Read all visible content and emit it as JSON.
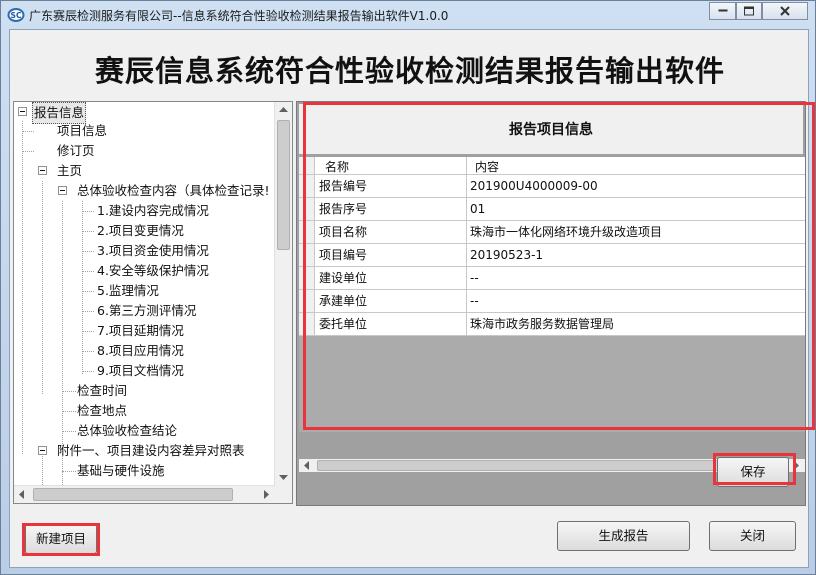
{
  "window": {
    "title": "广东赛辰检测服务有限公司--信息系统符合性验收检测结果报告输出软件V1.0.0",
    "logo_text": "SC",
    "controls": [
      "minimize-icon",
      "maximize-icon",
      "close-icon"
    ]
  },
  "header": {
    "title": "赛辰信息系统符合性验收检测结果报告输出软件"
  },
  "tree": {
    "nodes": [
      {
        "label": "报告信息",
        "expanded": true,
        "selected": true
      },
      {
        "label": "项目信息"
      },
      {
        "label": "修订页"
      },
      {
        "label": "主页",
        "expanded": true
      },
      {
        "label": "总体验收检查内容（具体检查记录!",
        "expanded": true
      },
      {
        "label": "1.建设内容完成情况"
      },
      {
        "label": "2.项目变更情况"
      },
      {
        "label": "3.项目资金使用情况"
      },
      {
        "label": "4.安全等级保护情况"
      },
      {
        "label": "5.监理情况"
      },
      {
        "label": "6.第三方测评情况"
      },
      {
        "label": "7.项目延期情况"
      },
      {
        "label": "8.项目应用情况"
      },
      {
        "label": "9.项目文档情况"
      },
      {
        "label": "检查时间"
      },
      {
        "label": "检查地点"
      },
      {
        "label": "总体验收检查结论"
      },
      {
        "label": "附件一、项目建设内容差异对照表",
        "expanded": true
      },
      {
        "label": "基础与硬件设施"
      }
    ]
  },
  "panel": {
    "section_title": "报告项目信息",
    "columns": {
      "name": "名称",
      "value": "内容"
    },
    "rows": [
      {
        "name": "报告编号",
        "value": "201900U4000009-00"
      },
      {
        "name": "报告序号",
        "value": "01"
      },
      {
        "name": "项目名称",
        "value": "珠海市一体化网络环境升级改造项目"
      },
      {
        "name": "项目编号",
        "value": "20190523-1"
      },
      {
        "name": "建设单位",
        "value": "--"
      },
      {
        "name": "承建单位",
        "value": "--"
      },
      {
        "name": "委托单位",
        "value": "珠海市政务服务数据管理局"
      }
    ]
  },
  "buttons": {
    "save": "保存",
    "new_project": "新建项目",
    "generate_report": "生成报告",
    "close": "关闭"
  },
  "colors": {
    "highlight": "#e8343a",
    "panel_bg": "#a0a0a0"
  }
}
